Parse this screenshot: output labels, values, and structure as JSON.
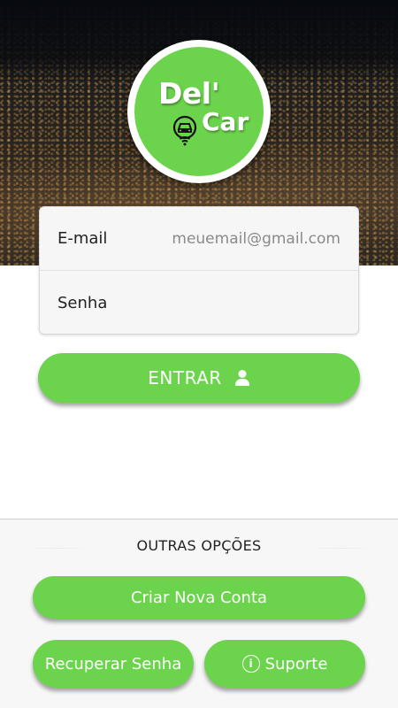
{
  "brand": {
    "word1": "Del'",
    "word2": "Car",
    "accent_color": "#6cd44c"
  },
  "login_form": {
    "email": {
      "label": "E-mail",
      "placeholder": "meuemail@gmail.com",
      "value": ""
    },
    "password": {
      "label": "Senha",
      "placeholder": "",
      "value": ""
    }
  },
  "login_button": {
    "label": "ENTRAR",
    "icon": "user-icon"
  },
  "other_options": {
    "title": "OUTRAS OPÇÕES",
    "create_account": "Criar Nova Conta",
    "recover_password": "Recuperar Senha",
    "support": {
      "label": "Suporte",
      "icon": "info-icon"
    }
  }
}
